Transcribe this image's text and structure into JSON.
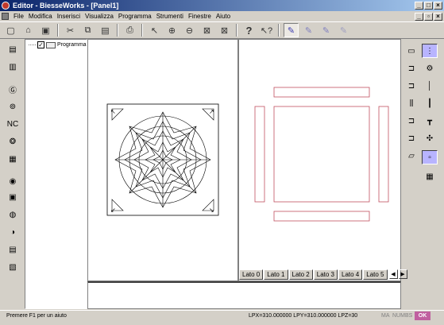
{
  "window": {
    "title": "Editor - BiesseWorks - [Panel1]"
  },
  "menu": [
    "File",
    "Modifica",
    "Inserisci",
    "Visualizza",
    "Programma",
    "Strumenti",
    "Finestre",
    "Aiuto"
  ],
  "tree": {
    "root_label": "Programma",
    "checked": true
  },
  "tabs": [
    "Lato 0",
    "Lato 1",
    "Lato 2",
    "Lato 3",
    "Lato 4",
    "Lato 5"
  ],
  "status": {
    "message": "Premere F1 per un aiuto",
    "coords": "LPX=310.000000  LPY=310.000000  LPZ=30",
    "indicators": [
      "MA",
      "NUM",
      "BS"
    ],
    "ok": "OK"
  },
  "toolbar_icons": [
    "new-icon",
    "open-icon",
    "save-icon",
    "cut-icon",
    "copy-icon",
    "paste-icon",
    "print-icon",
    "select-arrow-icon",
    "zoom-in-icon",
    "zoom-out-icon",
    "view-left-icon",
    "view-right-icon",
    "help-icon",
    "context-help-icon",
    "pencil-icon",
    "draw-tool-icon",
    "draw-tool-2-icon",
    "draw-tool-3-icon"
  ],
  "colors": {
    "titlebar_start": "#0a246a",
    "panel_outline": "#c05060",
    "active_tool": "#b8b4ff"
  }
}
